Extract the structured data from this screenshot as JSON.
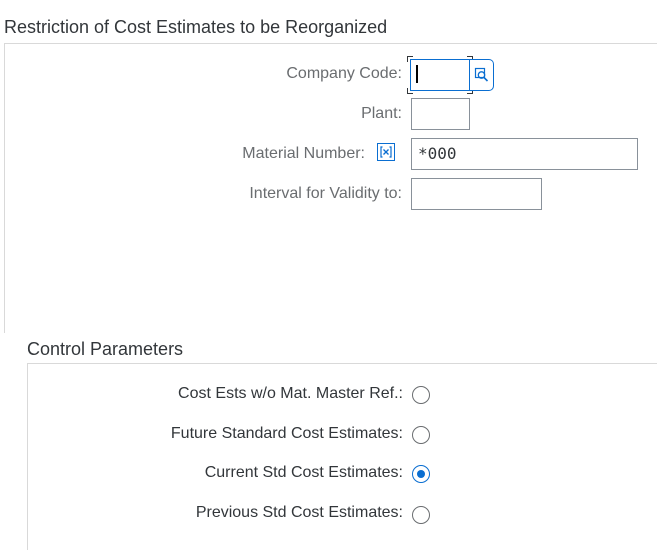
{
  "restriction": {
    "title": "Restriction of Cost Estimates to be Reorganized",
    "company_code": {
      "label": "Company Code:",
      "value": ""
    },
    "plant": {
      "label": "Plant:",
      "value": ""
    },
    "material_number": {
      "label": "Material Number:",
      "value": "*000"
    },
    "validity_interval": {
      "label": "Interval for Validity to:",
      "value": ""
    }
  },
  "control_parameters": {
    "title": "Control Parameters",
    "options": [
      {
        "label": "Cost Ests w/o Mat. Master Ref.:",
        "selected": false
      },
      {
        "label": "Future Standard Cost Estimates:",
        "selected": false
      },
      {
        "label": "Current Std Cost Estimates:",
        "selected": true
      },
      {
        "label": "Previous Std Cost Estimates:",
        "selected": false
      }
    ]
  },
  "icons": {
    "value_help": "search-icon",
    "multiple_selection": "multiple-selection-icon"
  },
  "colors": {
    "accent": "#0a6ed1",
    "text": "#32363a",
    "label": "#6a6d70",
    "border": "#89919a"
  }
}
